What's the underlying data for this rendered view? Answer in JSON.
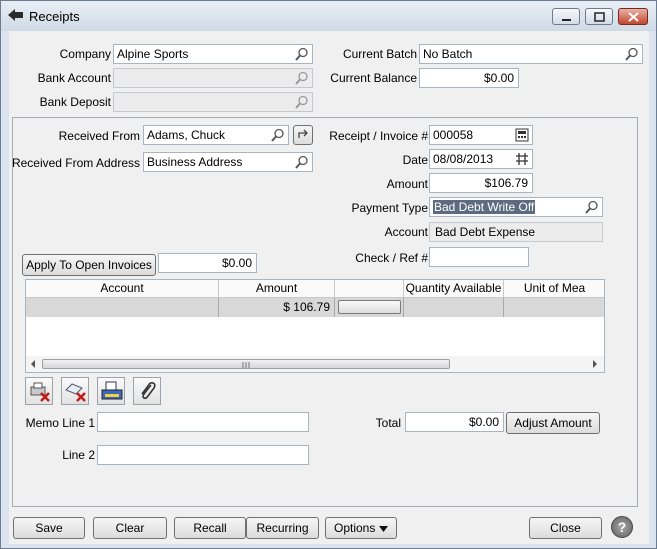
{
  "window": {
    "title": "Receipts",
    "app_icon": "back-arrow-icon"
  },
  "header": {
    "company_label": "Company",
    "company_value": "Alpine Sports",
    "bank_account_label": "Bank Account",
    "bank_account_value": "",
    "bank_deposit_label": "Bank Deposit",
    "bank_deposit_value": "",
    "current_batch_label": "Current Batch",
    "current_batch_value": "No Batch",
    "current_balance_label": "Current Balance",
    "current_balance_value": "$0.00"
  },
  "receipt": {
    "received_from_label": "Received From",
    "received_from_value": "Adams, Chuck",
    "received_from_address_label": "Received From Address",
    "received_from_address_value": "Business Address",
    "receipt_invoice_label": "Receipt / Invoice #",
    "receipt_invoice_value": "000058",
    "date_label": "Date",
    "date_value": "08/08/2013",
    "amount_label": "Amount",
    "amount_value": "$106.79",
    "payment_type_label": "Payment Type",
    "payment_type_value": "Bad Debt Write Off",
    "account_label": "Account",
    "account_value": "Bad Debt Expense",
    "check_ref_label": "Check / Ref #",
    "check_ref_value": "",
    "apply_button": "Apply To Open Invoices",
    "apply_amount": "$0.00"
  },
  "grid": {
    "columns": [
      "Account",
      "Amount",
      "",
      "Quantity Available",
      "Unit of Mea"
    ],
    "row": {
      "account": "",
      "amount": "$ 106.79"
    }
  },
  "toolbar_icons": [
    "delete-receipt-icon",
    "delete-line-icon",
    "print-icon",
    "attachment-icon"
  ],
  "memo": {
    "memo_line1_label": "Memo Line 1",
    "memo_line1_value": "",
    "line2_label": "Line 2",
    "line2_value": "",
    "total_label": "Total",
    "total_value": "$0.00",
    "adjust_button": "Adjust Amount"
  },
  "footer": {
    "save": "Save",
    "clear": "Clear",
    "recall": "Recall",
    "recurring": "Recurring",
    "options": "Options",
    "close": "Close",
    "help_icon": "help-icon"
  }
}
